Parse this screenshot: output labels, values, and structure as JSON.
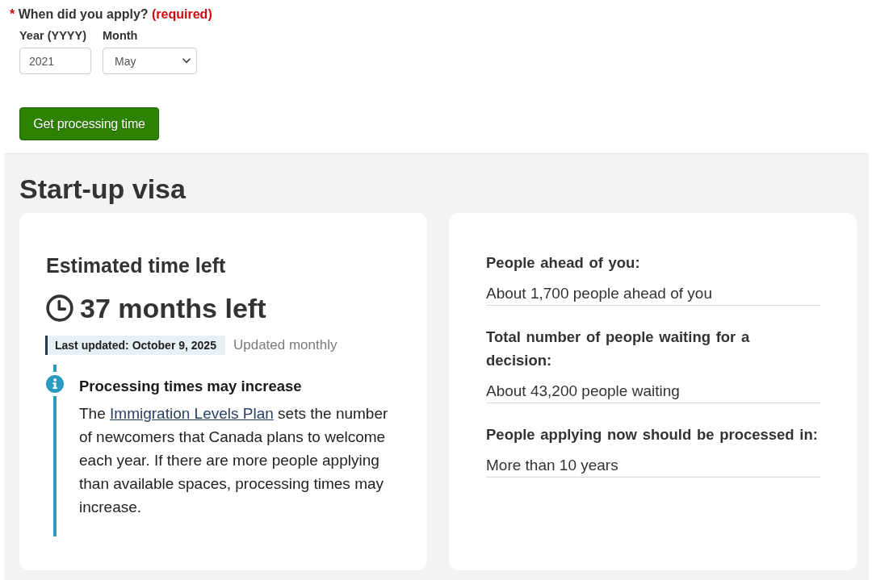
{
  "form": {
    "question": {
      "required_mark": "*",
      "label": "When did you apply?",
      "required_note": "(required)"
    },
    "fields": [
      {
        "kind": "text",
        "label": "Year (YYYY)",
        "value": "2021"
      },
      {
        "kind": "select",
        "label": "Month",
        "value": "May"
      }
    ],
    "submit_button": "Get processing time"
  },
  "result": {
    "title": "Start-up visa",
    "estimate": {
      "heading": "Estimated time left",
      "time_left": "37 months left",
      "last_updated": "Last updated: October 9, 2025",
      "update_frequency": "Updated monthly",
      "notice": {
        "heading": "Processing times may increase",
        "text_before": "The",
        "link": "Immigration Levels Plan",
        "text_after": "sets the number of newcomers that Canada plans to welcome each year. If there are more people applying than available spaces, processing times may increase."
      }
    },
    "stats": [
      {
        "label": "People ahead of you:",
        "value": "About 1,700 people ahead of you"
      },
      {
        "label": "Total number of people waiting for a decision:",
        "value": "About 43,200 people waiting"
      },
      {
        "label": "People applying now should be processed in:",
        "value": "More than 10 years"
      }
    ]
  }
}
